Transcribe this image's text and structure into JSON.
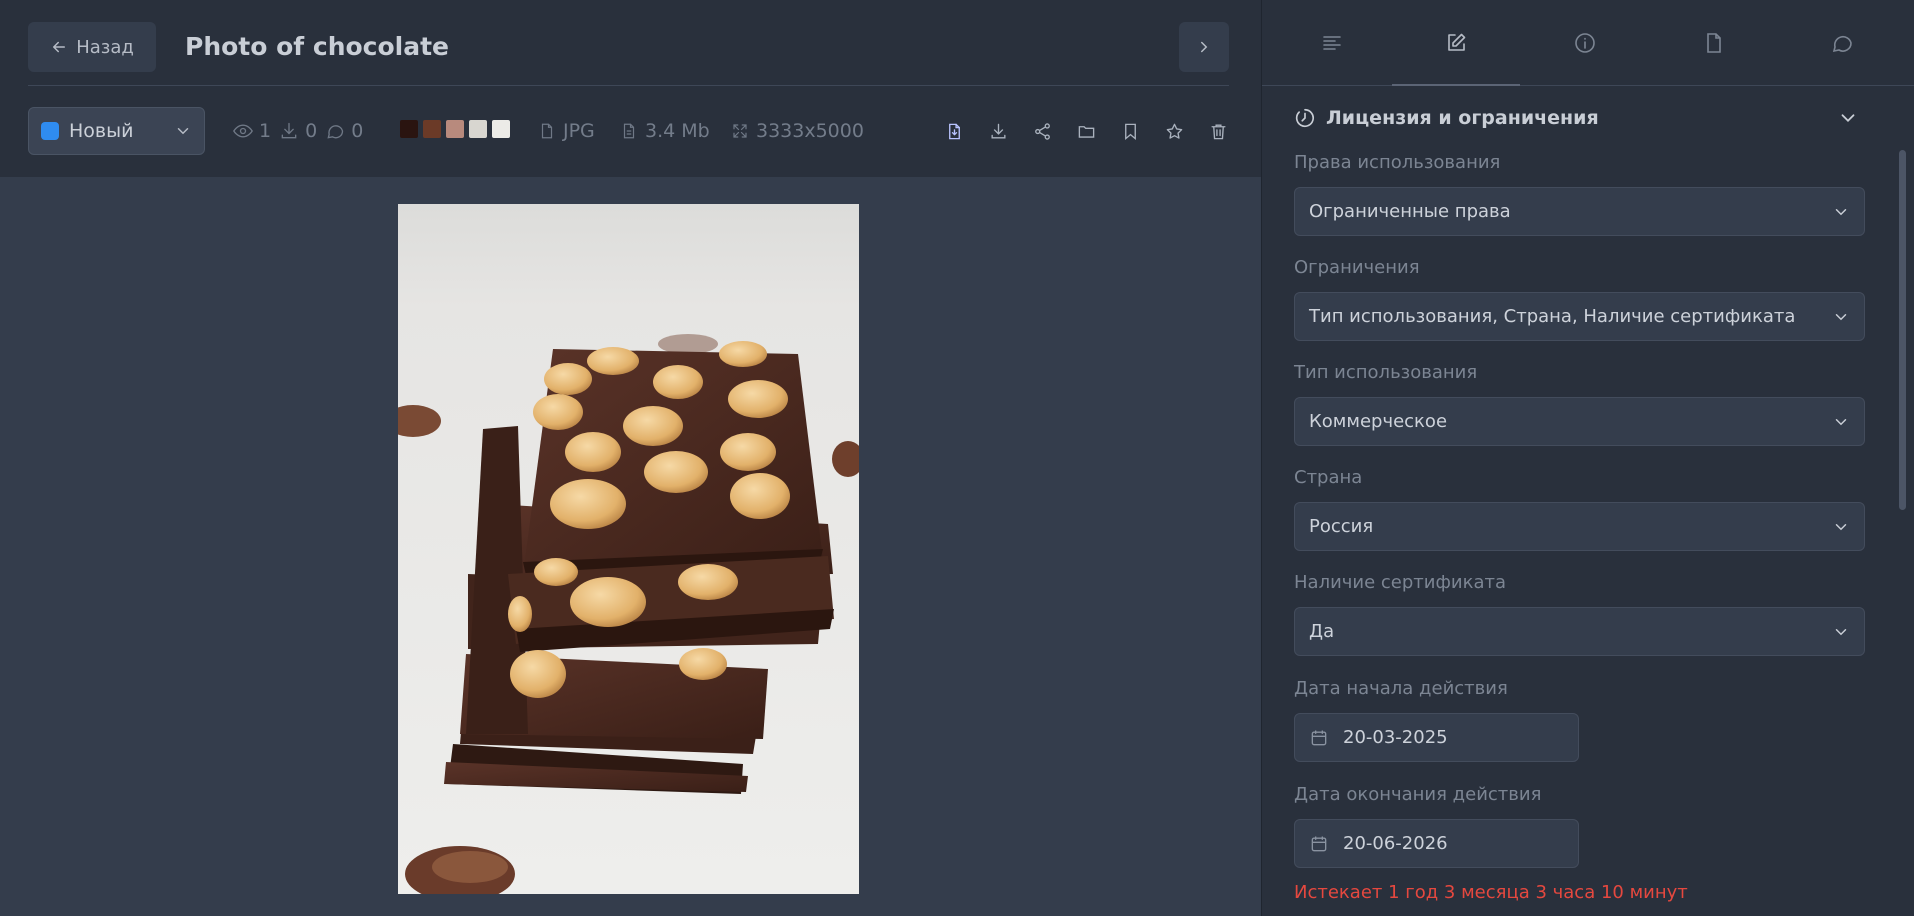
{
  "header": {
    "back_label": "Назад",
    "title": "Photo of chocolate"
  },
  "toolbar": {
    "status": {
      "label": "Новый",
      "color": "#2f8cf0"
    },
    "stats": {
      "views": "1",
      "downloads": "0",
      "comments": "0"
    },
    "palette": [
      "#2a1410",
      "#6b3a27",
      "#b88a7d",
      "#d8d6d0",
      "#ecebe7"
    ],
    "format": "JPG",
    "size": "3.4 Mb",
    "dimensions": "3333x5000",
    "actions": [
      "replace-file",
      "download",
      "share",
      "folder",
      "bookmark",
      "favorite",
      "delete"
    ]
  },
  "sidebar": {
    "tabs": [
      "description",
      "edit",
      "info",
      "file",
      "comments"
    ],
    "active_tab": "edit",
    "section": {
      "title": "Лицензия и ограничения"
    },
    "fields": {
      "usage_rights": {
        "label": "Права использования",
        "value": "Ограниченные права"
      },
      "restrictions": {
        "label": "Ограничения",
        "value": "Тип использования, Страна, Наличие сертификата"
      },
      "usage_type": {
        "label": "Тип использования",
        "value": "Коммерческое"
      },
      "country": {
        "label": "Страна",
        "value": "Россия"
      },
      "certificate": {
        "label": "Наличие сертификата",
        "value": "Да"
      },
      "start_date": {
        "label": "Дата начала действия",
        "value": "20-03-2025"
      },
      "end_date": {
        "label": "Дата окончания действия",
        "value": "20-06-2026"
      }
    },
    "expiry_notice": "Истекает 1 год 3 месяца 3 часа 10 минут"
  }
}
